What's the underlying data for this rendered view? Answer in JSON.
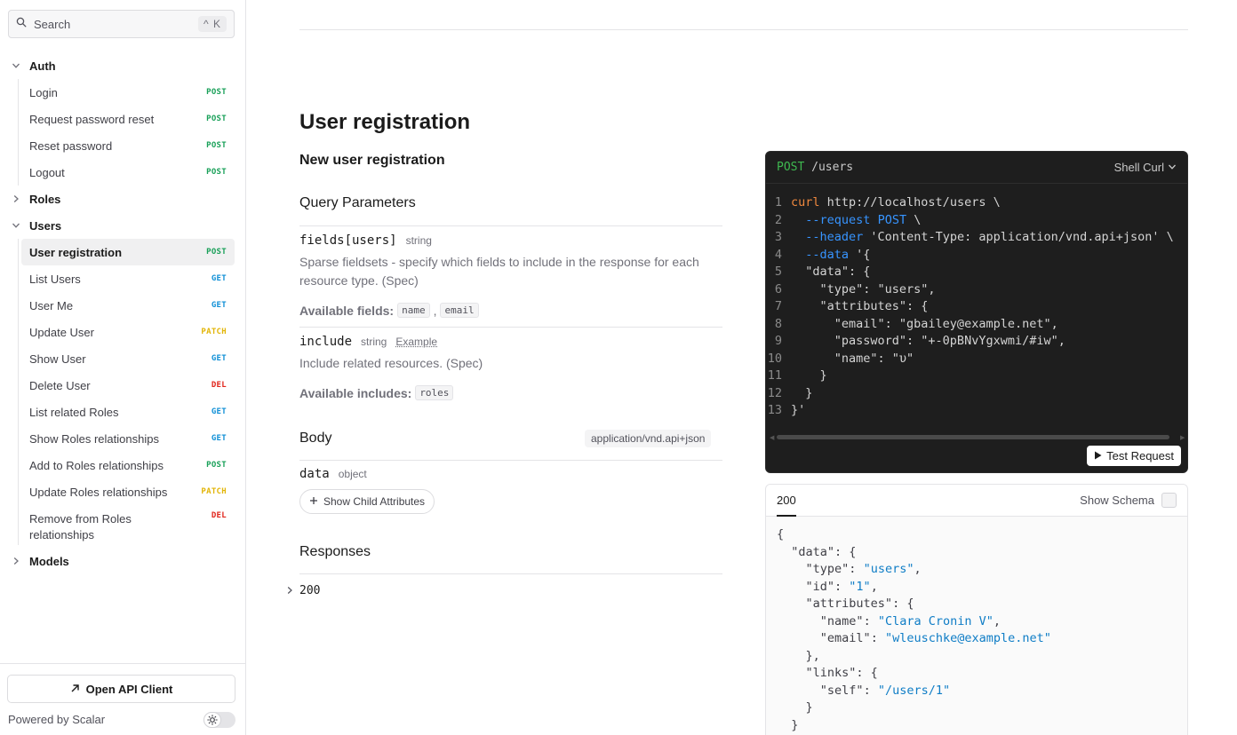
{
  "sidebar": {
    "search": {
      "placeholder": "Search",
      "shortcut": "^ K"
    },
    "groups": {
      "auth": "Auth",
      "roles": "Roles",
      "users": "Users",
      "models": "Models"
    },
    "auth_items": [
      {
        "label": "Login",
        "method": "POST"
      },
      {
        "label": "Request password reset",
        "method": "POST"
      },
      {
        "label": "Reset password",
        "method": "POST"
      },
      {
        "label": "Logout",
        "method": "POST"
      }
    ],
    "user_items": [
      {
        "label": "User registration",
        "method": "POST"
      },
      {
        "label": "List Users",
        "method": "GET"
      },
      {
        "label": "User Me",
        "method": "GET"
      },
      {
        "label": "Update User",
        "method": "PATCH"
      },
      {
        "label": "Show User",
        "method": "GET"
      },
      {
        "label": "Delete User",
        "method": "DEL"
      },
      {
        "label": "List related Roles",
        "method": "GET"
      },
      {
        "label": "Show Roles relationships",
        "method": "GET"
      },
      {
        "label": "Add to Roles relationships",
        "method": "POST"
      },
      {
        "label": "Update Roles relationships",
        "method": "PATCH"
      },
      {
        "label": "Remove from Roles relationships",
        "method": "DEL"
      }
    ],
    "footer": {
      "open_client": "Open API Client",
      "powered_by": "Powered by Scalar"
    }
  },
  "main": {
    "title": "User registration",
    "subtitle": "New user registration",
    "query_params_title": "Query Parameters",
    "params": [
      {
        "name": "fields[users]",
        "type": "string",
        "description": "Sparse fieldsets - specify which fields to include in the response for each resource type. (Spec)",
        "available_label": "Available fields:",
        "available": [
          "name",
          "email"
        ]
      },
      {
        "name": "include",
        "type": "string",
        "example_label": "Example",
        "description": "Include related resources. (Spec)",
        "available_label": "Available includes:",
        "available": [
          "roles"
        ]
      }
    ],
    "body": {
      "title": "Body",
      "content_type": "application/vnd.api+json",
      "field_name": "data",
      "field_type": "object",
      "child_button": "Show Child Attributes"
    },
    "responses": {
      "title": "Responses",
      "code": "200"
    }
  },
  "code_panel": {
    "method": "POST",
    "path": "/users",
    "language": "Shell Curl",
    "lines": [
      "curl http://localhost/users \\",
      "  --request POST \\",
      "  --header 'Content-Type: application/vnd.api+json'",
      "  --data '{",
      "  \"data\": {",
      "    \"type\": \"users\",",
      "    \"attributes\": {",
      "      \"email\": \"gbailey@example.net\",",
      "      \"password\": \"+-0pBNvYgxwmi/#iw\",",
      "      \"name\": \"υ\"",
      "    }",
      "  }",
      "}'"
    ],
    "test_button": "Test Request"
  },
  "response_panel": {
    "tab": "200",
    "show_schema": "Show Schema",
    "lines": [
      "{",
      "  \"data\": {",
      "    \"type\": \"users\",",
      "    \"id\": \"1\",",
      "    \"attributes\": {",
      "      \"name\": \"Clara Cronin V\",",
      "      \"email\": \"wleuschke@example.net\"",
      "    },",
      "    \"links\": {",
      "      \"self\": \"/users/1\"",
      "    }",
      "  }"
    ]
  },
  "colors": {
    "post": "#18a058",
    "get": "#0f8fd6",
    "patch": "#e2b508",
    "del": "#e1251b",
    "code_bg": "#1e1e1e"
  }
}
